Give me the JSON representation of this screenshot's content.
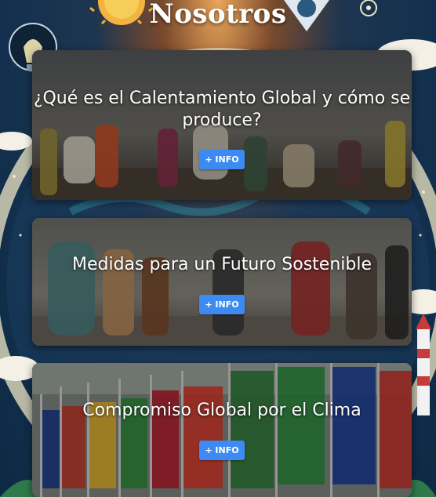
{
  "page": {
    "title": "Nosotros"
  },
  "cards": [
    {
      "title": "¿Qué es el Calentamiento Global y cómo se produce?",
      "button_label": "+ INFO"
    },
    {
      "title": "Medidas para un Futuro Sostenible",
      "button_label": "+ INFO"
    },
    {
      "title": "Compromiso Global por el Clima",
      "button_label": "+ INFO"
    }
  ],
  "colors": {
    "button": "#3d8bf2",
    "title": "#ffffff"
  },
  "icons": [
    "sun-icon",
    "lightbulb-icon",
    "location-pin-icon",
    "target-icon",
    "globe-icon",
    "lighthouse-icon",
    "cloud-icon"
  ]
}
